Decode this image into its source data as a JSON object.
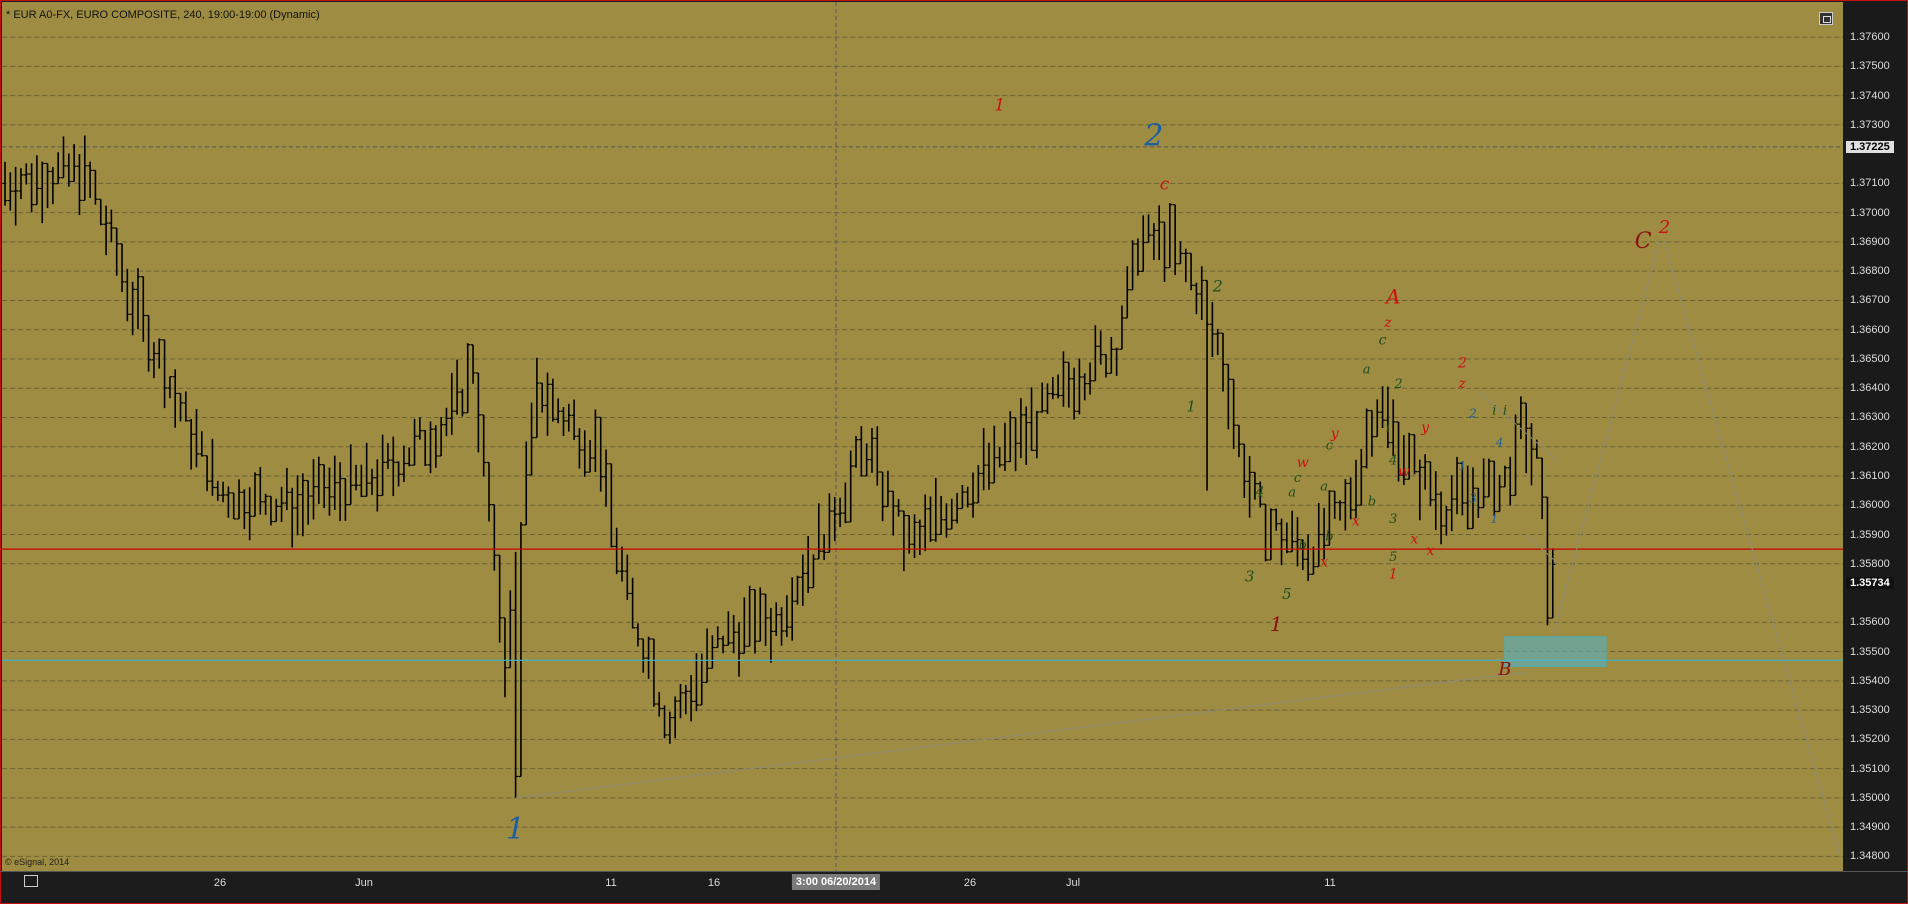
{
  "window": {
    "header": "* EUR A0-FX, EURO COMPOSITE, 240, 19:00-19:00 (Dynamic)",
    "copyright": "© eSignal, 2014"
  },
  "colors": {
    "plot_bg": "#9e8c42",
    "price_axis_bg": "#1a1a1a",
    "bar": "#000000",
    "red_line": "#cc0000",
    "cyan_line": "#3fb3c8",
    "wave_blue": "#1e5fa0",
    "wave_red": "#cc1111",
    "wave_green": "#1e4d1e",
    "wave_darkred": "#8b1010"
  },
  "chart_data": {
    "type": "ohlc",
    "timeframe": "240",
    "x_ticks": [
      "26",
      "Jun",
      "11",
      "16",
      "26",
      "Jul",
      "11"
    ],
    "cursor_time_label": "3:00 06/20/2014",
    "y_range": [
      1.3475,
      1.3772
    ],
    "y_ticks": [
      "1.37600",
      "1.37500",
      "1.37400",
      "1.37300",
      "1.37225",
      "1.37100",
      "1.37000",
      "1.36900",
      "1.36800",
      "1.36700",
      "1.36600",
      "1.36500",
      "1.36400",
      "1.36300",
      "1.36200",
      "1.36100",
      "1.36000",
      "1.35900",
      "1.35800",
      "1.35734",
      "1.35600",
      "1.35500",
      "1.35400",
      "1.35300",
      "1.35200",
      "1.35100",
      "1.35000",
      "1.34900",
      "1.34800"
    ],
    "last_price": "1.35734",
    "cursor_price": "1.37225",
    "horizontal_lines": [
      {
        "name": "red-level",
        "price": 1.3585
      },
      {
        "name": "cyan-level",
        "price": 1.3547
      }
    ],
    "anchors": [
      {
        "bar": 0,
        "mid": 1.371
      },
      {
        "bar": 15,
        "mid": 1.3715
      },
      {
        "bar": 25,
        "mid": 1.3665
      },
      {
        "bar": 40,
        "mid": 1.3605
      },
      {
        "bar": 55,
        "mid": 1.36
      },
      {
        "bar": 70,
        "mid": 1.361
      },
      {
        "bar": 84,
        "mid": 1.363
      },
      {
        "bar": 88,
        "mid": 1.365
      },
      {
        "bar": 94,
        "mid": 1.3545
      },
      {
        "bar": 100,
        "mid": 1.364
      },
      {
        "bar": 111,
        "mid": 1.362
      },
      {
        "bar": 117,
        "mid": 1.357
      },
      {
        "bar": 125,
        "mid": 1.3525
      },
      {
        "bar": 135,
        "mid": 1.3555
      },
      {
        "bar": 145,
        "mid": 1.356
      },
      {
        "bar": 155,
        "mid": 1.3595
      },
      {
        "bar": 162,
        "mid": 1.362
      },
      {
        "bar": 170,
        "mid": 1.3585
      },
      {
        "bar": 180,
        "mid": 1.3605
      },
      {
        "bar": 192,
        "mid": 1.3625
      },
      {
        "bar": 202,
        "mid": 1.3645
      },
      {
        "bar": 209,
        "mid": 1.3655
      },
      {
        "bar": 213,
        "mid": 1.369
      },
      {
        "bar": 219,
        "mid": 1.369
      },
      {
        "bar": 224,
        "mid": 1.3675
      },
      {
        "bar": 229,
        "mid": 1.365
      },
      {
        "bar": 232,
        "mid": 1.362
      },
      {
        "bar": 235,
        "mid": 1.36
      },
      {
        "bar": 240,
        "mid": 1.359
      },
      {
        "bar": 245,
        "mid": 1.3585
      },
      {
        "bar": 252,
        "mid": 1.3598
      },
      {
        "bar": 258,
        "mid": 1.3635
      },
      {
        "bar": 264,
        "mid": 1.3615
      },
      {
        "bar": 270,
        "mid": 1.36
      },
      {
        "bar": 276,
        "mid": 1.3603
      },
      {
        "bar": 282,
        "mid": 1.3608
      },
      {
        "bar": 285,
        "mid": 1.3625
      },
      {
        "bar": 288,
        "mid": 1.3615
      },
      {
        "bar": 290,
        "mid": 1.3575
      },
      {
        "bar": 291,
        "mid": 1.3573
      }
    ],
    "spikes": [
      {
        "bar": 96,
        "low": 1.35
      },
      {
        "bar": 226,
        "low": 1.3605
      },
      {
        "bar": 172,
        "low": 1.3583
      },
      {
        "bar": 290,
        "low": 1.3559
      }
    ],
    "trendlines": [
      {
        "name": "lower-trendline",
        "from": {
          "bar": 96,
          "price": 1.35
        },
        "to": {
          "bar": 286,
          "price": 1.3543
        }
      },
      {
        "name": "projection-up",
        "from": {
          "bar": 291,
          "price": 1.3555
        },
        "to": {
          "bar": 311,
          "price": 1.369
        }
      },
      {
        "name": "projection-down",
        "from": {
          "bar": 312,
          "price": 1.369
        },
        "to": {
          "bar": 345,
          "price": 1.348
        }
      },
      {
        "name": "triangle-upper",
        "from": {
          "bar": 277,
          "price": 1.3639
        },
        "to": {
          "bar": 292,
          "price": 1.3615
        }
      },
      {
        "name": "triangle-lower",
        "from": {
          "bar": 286,
          "price": 1.359
        },
        "to": {
          "bar": 292,
          "price": 1.358
        }
      }
    ],
    "target_box": {
      "bar_start": 282,
      "bar_end": 301,
      "price_low": 1.3545,
      "price_high": 1.3555
    },
    "wave_labels": [
      {
        "text": "1",
        "bar": 96,
        "price": 1.3486,
        "color": "wave_blue",
        "size": 30
      },
      {
        "text": "2",
        "bar": 216,
        "price": 1.3723,
        "color": "wave_blue",
        "size": 30
      },
      {
        "text": "1",
        "bar": 187,
        "price": 1.3735,
        "color": "wave_red",
        "size": 17
      },
      {
        "text": "c",
        "bar": 218,
        "price": 1.3708,
        "color": "wave_red",
        "size": 17
      },
      {
        "text": "2",
        "bar": 228,
        "price": 1.3673,
        "color": "wave_green",
        "size": 16
      },
      {
        "text": "1",
        "bar": 223,
        "price": 1.3632,
        "color": "wave_green",
        "size": 15
      },
      {
        "text": "A",
        "bar": 261,
        "price": 1.3669,
        "color": "wave_red",
        "size": 20
      },
      {
        "text": "z",
        "bar": 260,
        "price": 1.3661,
        "color": "wave_red",
        "size": 14
      },
      {
        "text": "c",
        "bar": 259,
        "price": 1.3655,
        "color": "wave_green",
        "size": 14
      },
      {
        "text": "a",
        "bar": 256,
        "price": 1.3645,
        "color": "wave_green",
        "size": 13
      },
      {
        "text": "2",
        "bar": 262,
        "price": 1.364,
        "color": "wave_green",
        "size": 13
      },
      {
        "text": "y",
        "bar": 250,
        "price": 1.3623,
        "color": "wave_red",
        "size": 14
      },
      {
        "text": "c",
        "bar": 249,
        "price": 1.3619,
        "color": "wave_green",
        "size": 13
      },
      {
        "text": "i",
        "bar": 260,
        "price": 1.3625,
        "color": "wave_green",
        "size": 13
      },
      {
        "text": "w",
        "bar": 244,
        "price": 1.3613,
        "color": "wave_red",
        "size": 14
      },
      {
        "text": "c",
        "bar": 243,
        "price": 1.3608,
        "color": "wave_green",
        "size": 13
      },
      {
        "text": "4",
        "bar": 236,
        "price": 1.3603,
        "color": "wave_green",
        "size": 14
      },
      {
        "text": "a",
        "bar": 242,
        "price": 1.3603,
        "color": "wave_green",
        "size": 13
      },
      {
        "text": "a",
        "bar": 248,
        "price": 1.3605,
        "color": "wave_green",
        "size": 13
      },
      {
        "text": "b",
        "bar": 257,
        "price": 1.36,
        "color": "wave_green",
        "size": 13
      },
      {
        "text": "x",
        "bar": 254,
        "price": 1.3593,
        "color": "wave_red",
        "size": 14
      },
      {
        "text": "b",
        "bar": 244,
        "price": 1.3585,
        "color": "wave_green",
        "size": 13
      },
      {
        "text": "b",
        "bar": 249,
        "price": 1.3588,
        "color": "wave_green",
        "size": 13
      },
      {
        "text": "x",
        "bar": 248,
        "price": 1.3579,
        "color": "wave_red",
        "size": 14
      },
      {
        "text": "3",
        "bar": 234,
        "price": 1.3574,
        "color": "wave_green",
        "size": 15
      },
      {
        "text": "5",
        "bar": 241,
        "price": 1.3568,
        "color": "wave_green",
        "size": 15
      },
      {
        "text": "1",
        "bar": 239,
        "price": 1.3557,
        "color": "wave_darkred",
        "size": 20
      },
      {
        "text": "4",
        "bar": 261,
        "price": 1.3614,
        "color": "wave_green",
        "size": 13
      },
      {
        "text": "w",
        "bar": 263,
        "price": 1.361,
        "color": "wave_red",
        "size": 14
      },
      {
        "text": "3",
        "bar": 261,
        "price": 1.3594,
        "color": "wave_green",
        "size": 13
      },
      {
        "text": "x",
        "bar": 265,
        "price": 1.3587,
        "color": "wave_red",
        "size": 14
      },
      {
        "text": "x",
        "bar": 268,
        "price": 1.3583,
        "color": "wave_red",
        "size": 14
      },
      {
        "text": "5",
        "bar": 261,
        "price": 1.3581,
        "color": "wave_green",
        "size": 13
      },
      {
        "text": "1",
        "bar": 261,
        "price": 1.3575,
        "color": "wave_red",
        "size": 14
      },
      {
        "text": "y",
        "bar": 267,
        "price": 1.3625,
        "color": "wave_red",
        "size": 14
      },
      {
        "text": "2",
        "bar": 274,
        "price": 1.3647,
        "color": "wave_red",
        "size": 14
      },
      {
        "text": "z",
        "bar": 274,
        "price": 1.364,
        "color": "wave_red",
        "size": 14
      },
      {
        "text": "2",
        "bar": 276,
        "price": 1.363,
        "color": "wave_blue",
        "size": 12
      },
      {
        "text": "i",
        "bar": 280,
        "price": 1.3631,
        "color": "wave_green",
        "size": 13
      },
      {
        "text": "i",
        "bar": 282,
        "price": 1.3631,
        "color": "wave_green",
        "size": 13
      },
      {
        "text": "4",
        "bar": 281,
        "price": 1.362,
        "color": "wave_blue",
        "size": 12
      },
      {
        "text": "1",
        "bar": 274,
        "price": 1.3612,
        "color": "wave_blue",
        "size": 12
      },
      {
        "text": "3",
        "bar": 276,
        "price": 1.3601,
        "color": "wave_blue",
        "size": 12
      },
      {
        "text": "1",
        "bar": 280,
        "price": 1.3594,
        "color": "wave_blue",
        "size": 12
      },
      {
        "text": "C",
        "bar": 308,
        "price": 1.3688,
        "color": "wave_darkred",
        "size": 22
      },
      {
        "text": "2",
        "bar": 312,
        "price": 1.3693,
        "color": "wave_red",
        "size": 18
      },
      {
        "text": "B",
        "bar": 282,
        "price": 1.3542,
        "color": "wave_darkred",
        "size": 18
      }
    ]
  }
}
